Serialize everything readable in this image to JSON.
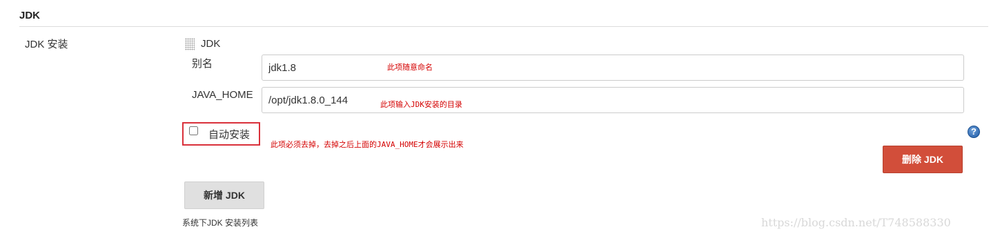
{
  "section": {
    "title": "JDK"
  },
  "row": {
    "label": "JDK 安装"
  },
  "installation": {
    "title": "JDK",
    "alias_label": "别名",
    "alias_value": "jdk1.8",
    "alias_note": "此项随意命名",
    "home_label": "JAVA_HOME",
    "home_value": "/opt/jdk1.8.0_144",
    "home_note": "此项输入JDK安装的目录",
    "auto_install_label": "自动安装",
    "auto_install_checked": false,
    "auto_install_note": "此项必须去掉，去掉之后上面的JAVA_HOME才会展示出来",
    "help_glyph": "?",
    "delete_label": "删除 JDK"
  },
  "add": {
    "label": "新增 JDK",
    "description": "系统下JDK 安装列表"
  },
  "watermark": "https://blog.csdn.net/T748588330",
  "icons": {
    "help": "help-icon",
    "drag_handle": "drag-handle-icon"
  },
  "colors": {
    "delete_button": "#d24e3a",
    "note_text": "#d40000",
    "highlight_border": "#d9303a"
  }
}
